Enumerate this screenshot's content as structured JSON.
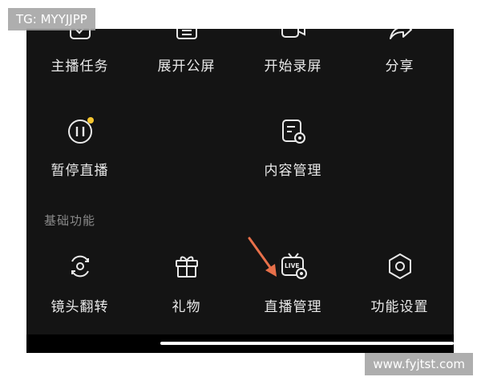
{
  "watermark_top": "TG: MYYJJPP",
  "watermark_bottom": "www.fyjtst.com",
  "menu_row1": [
    {
      "label": "主播任务",
      "icon": "task-check-icon"
    },
    {
      "label": "展开公屏",
      "icon": "chat-list-icon"
    },
    {
      "label": "开始录屏",
      "icon": "record-camera-icon"
    },
    {
      "label": "分享",
      "icon": "share-arrow-icon"
    }
  ],
  "menu_row2": [
    {
      "label": "暂停直播",
      "icon": "pause-icon",
      "badge_color": "#f5c530"
    },
    {
      "label": "内容管理",
      "icon": "content-manage-icon"
    }
  ],
  "section_title": "基础功能",
  "menu_row3": [
    {
      "label": "镜头翻转",
      "icon": "camera-flip-icon"
    },
    {
      "label": "礼物",
      "icon": "gift-icon"
    },
    {
      "label": "直播管理",
      "icon": "live-manage-icon",
      "icon_text": "LIVE"
    },
    {
      "label": "功能设置",
      "icon": "settings-hexagon-icon"
    }
  ],
  "annotation_color": "#e8704a"
}
